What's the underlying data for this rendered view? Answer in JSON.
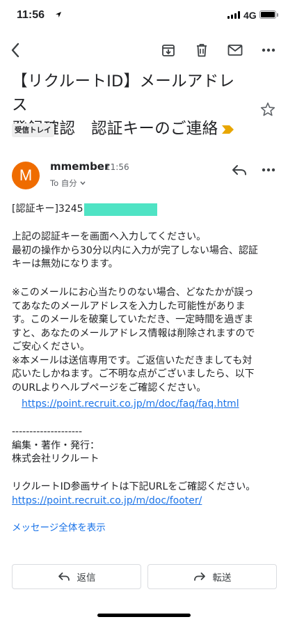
{
  "status_bar": {
    "time": "11:56",
    "network": "4G"
  },
  "toolbar": {
    "back_icon": "back-arrow-icon",
    "archive_icon": "archive-icon",
    "delete_icon": "trash-icon",
    "mark_unread_icon": "mail-icon",
    "more_icon": "more-dots-icon"
  },
  "email": {
    "subject_line1": "【リクルートID】メールアドレス",
    "subject_line2": "登録確認　認証キーのご連絡",
    "label": "受信トレイ",
    "sender": {
      "avatar_letter": "M",
      "avatar_color": "#ef6c00",
      "name": "mmember",
      "time": "11:56",
      "to": "To 自分"
    },
    "body": {
      "code_prefix": "[認証キー]3245",
      "p1_l1": "上記の認証キーを画面へ入力してください。",
      "p1_l2": "最初の操作から30分以内に入力が完了しない場合、認証",
      "p1_l3": "キーは無効になります。",
      "p2_l1": "※このメールにお心当たりのない場合、どなたかが誤っ",
      "p2_l2": "てあなたのメールアドレスを入力した可能性がありま",
      "p2_l3": "す。このメールを破棄していただき、一定時間を過ぎま",
      "p2_l4": "すと、あなたのメールアドレス情報は削除されますので",
      "p2_l5": "ご安心ください。",
      "p2_l6": "※本メールは送信専用です。ご返信いただきましても対",
      "p2_l7": "応いたしかねます。ご不明な点がございましたら、以下",
      "p2_l8": "のURLよりヘルプページをご確認ください。",
      "faq_link": "https://point.recruit.co.jp/m/doc/faq/faq.html",
      "divider": "--------------------",
      "p3_l1": "編集・著作・発行：",
      "p3_l2": "株式会社リクルート",
      "p4_l1": "リクルートID参画サイトは下記URLをご確認ください。",
      "footer_link": "https://point.recruit.co.jp/m/doc/footer/"
    },
    "show_all": "メッセージ全体を表示"
  },
  "actions": {
    "reply_label": "返信",
    "forward_label": "転送"
  },
  "colors": {
    "link": "#1a73e8",
    "importance_marker": "#e8a600",
    "redaction": "#4fe3c4"
  }
}
